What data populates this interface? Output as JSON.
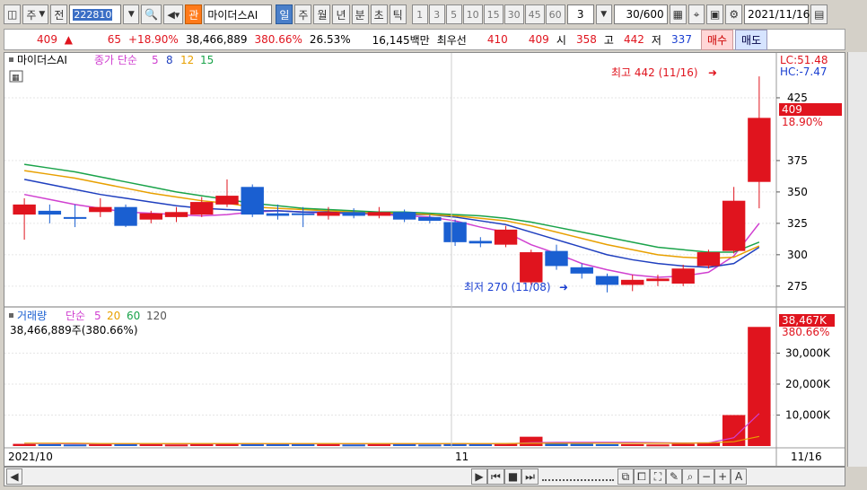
{
  "toolbar": {
    "type_label": "주",
    "prev_label": "전",
    "code": "222810",
    "guan_label": "관",
    "stock_name": "마이더스AI",
    "periods": [
      "일",
      "주",
      "월",
      "년",
      "분",
      "초",
      "틱"
    ],
    "selected_period": "일",
    "intervals": [
      "1",
      "3",
      "5",
      "10",
      "15",
      "30",
      "45",
      "60"
    ],
    "count_value": "3",
    "range_value": "30/600",
    "date_value": "2021/11/16"
  },
  "info": {
    "price": "409",
    "change": "65",
    "change_pct": "+18.90%",
    "volume": "38,466,889",
    "vol_ratio": "380.66%",
    "turnover": "26.53%",
    "amount": "16,145백만",
    "priority_label": "최우선",
    "ask": "410",
    "bid": "409",
    "open_label": "시",
    "open": "358",
    "high_label": "고",
    "high": "442",
    "low_label": "저",
    "low": "337",
    "buy_label": "매수",
    "sell_label": "매도"
  },
  "legend": {
    "stock": "마이더스AI",
    "ma_label": "종가 단순",
    "ma_periods": [
      "5",
      "8",
      "12",
      "15"
    ],
    "vol_label": "거래량",
    "vol_ma_label": "단순",
    "vol_ma_periods": [
      "5",
      "20",
      "60",
      "120"
    ],
    "vol_value": "38,466,889주(380.66%)"
  },
  "right_labels": {
    "lc": "LC:51.48",
    "hc": "HC:-7.47",
    "price_tag": "409",
    "price_pct": "18.90%",
    "vol_tag": "38,467K",
    "vol_pct": "380.66%"
  },
  "annotations": {
    "high": "최고 442 (11/16)",
    "low": "최저 270 (11/08)"
  },
  "xlabels": {
    "start": "2021/10",
    "mid": "11",
    "end": "11/16"
  },
  "colors": {
    "up": "#e0141e",
    "down": "#1a5fd1"
  },
  "chart_data": {
    "type": "candlestick",
    "ylim": [
      262,
      455
    ],
    "yticks": [
      275,
      300,
      325,
      350,
      375,
      425
    ],
    "vol_ticks": [
      "10,000K",
      "20,000K",
      "30,000K"
    ],
    "vol_ylim": [
      0,
      40000
    ],
    "candles": [
      {
        "o": 332,
        "h": 345,
        "l": 312,
        "c": 340
      },
      {
        "o": 335,
        "h": 340,
        "l": 325,
        "c": 332
      },
      {
        "o": 330,
        "h": 340,
        "l": 322,
        "c": 329
      },
      {
        "o": 334,
        "h": 345,
        "l": 330,
        "c": 338
      },
      {
        "o": 338,
        "h": 340,
        "l": 322,
        "c": 323
      },
      {
        "o": 328,
        "h": 335,
        "l": 325,
        "c": 333
      },
      {
        "o": 330,
        "h": 338,
        "l": 326,
        "c": 334
      },
      {
        "o": 332,
        "h": 346,
        "l": 330,
        "c": 342
      },
      {
        "o": 340,
        "h": 360,
        "l": 338,
        "c": 347
      },
      {
        "o": 354,
        "h": 356,
        "l": 330,
        "c": 332
      },
      {
        "o": 333,
        "h": 340,
        "l": 328,
        "c": 331
      },
      {
        "o": 333,
        "h": 338,
        "l": 322,
        "c": 332
      },
      {
        "o": 331,
        "h": 338,
        "l": 328,
        "c": 334
      },
      {
        "o": 334,
        "h": 337,
        "l": 329,
        "c": 331
      },
      {
        "o": 331,
        "h": 338,
        "l": 329,
        "c": 334
      },
      {
        "o": 334,
        "h": 336,
        "l": 326,
        "c": 328
      },
      {
        "o": 330,
        "h": 332,
        "l": 325,
        "c": 327
      },
      {
        "o": 326,
        "h": 328,
        "l": 307,
        "c": 310
      },
      {
        "o": 311,
        "h": 314,
        "l": 306,
        "c": 309
      },
      {
        "o": 308,
        "h": 323,
        "l": 306,
        "c": 320
      },
      {
        "o": 278,
        "h": 304,
        "l": 276,
        "c": 302
      },
      {
        "o": 303,
        "h": 308,
        "l": 288,
        "c": 291
      },
      {
        "o": 290,
        "h": 293,
        "l": 281,
        "c": 285
      },
      {
        "o": 283,
        "h": 285,
        "l": 270,
        "c": 276
      },
      {
        "o": 276,
        "h": 284,
        "l": 271,
        "c": 280
      },
      {
        "o": 279,
        "h": 284,
        "l": 275,
        "c": 281
      },
      {
        "o": 277,
        "h": 292,
        "l": 275,
        "c": 289
      },
      {
        "o": 291,
        "h": 304,
        "l": 289,
        "c": 302
      },
      {
        "o": 303,
        "h": 354,
        "l": 301,
        "c": 343
      },
      {
        "o": 358,
        "h": 442,
        "l": 337,
        "c": 409
      }
    ],
    "volumes": [
      700,
      600,
      500,
      600,
      700,
      600,
      500,
      800,
      700,
      900,
      700,
      600,
      600,
      500,
      600,
      700,
      500,
      900,
      600,
      900,
      3000,
      1000,
      700,
      600,
      600,
      500,
      700,
      1200,
      10000,
      38467
    ],
    "ma_series": [
      {
        "name": "5",
        "color": "#d040d0",
        "values": [
          348,
          344,
          340,
          337,
          334,
          333,
          332,
          331,
          332,
          334,
          335,
          334,
          333,
          333,
          332,
          331,
          330,
          327,
          322,
          318,
          308,
          301,
          293,
          288,
          284,
          282,
          283,
          286,
          299,
          325
        ]
      },
      {
        "name": "8",
        "color": "#1f3fbf",
        "values": [
          360,
          356,
          352,
          348,
          345,
          342,
          339,
          337,
          336,
          335,
          335,
          334,
          334,
          333,
          333,
          332,
          332,
          330,
          327,
          324,
          318,
          312,
          306,
          300,
          296,
          293,
          291,
          290,
          293,
          306
        ]
      },
      {
        "name": "12",
        "color": "#e8a000",
        "values": [
          367,
          364,
          361,
          357,
          353,
          349,
          346,
          343,
          341,
          338,
          337,
          336,
          335,
          334,
          333,
          333,
          332,
          331,
          329,
          327,
          323,
          318,
          313,
          308,
          304,
          300,
          298,
          297,
          298,
          307
        ]
      },
      {
        "name": "15",
        "color": "#1aa34a",
        "values": [
          372,
          369,
          366,
          362,
          358,
          354,
          350,
          347,
          344,
          341,
          339,
          337,
          336,
          335,
          334,
          334,
          333,
          332,
          331,
          329,
          326,
          322,
          318,
          314,
          310,
          306,
          304,
          302,
          302,
          310
        ]
      }
    ]
  }
}
